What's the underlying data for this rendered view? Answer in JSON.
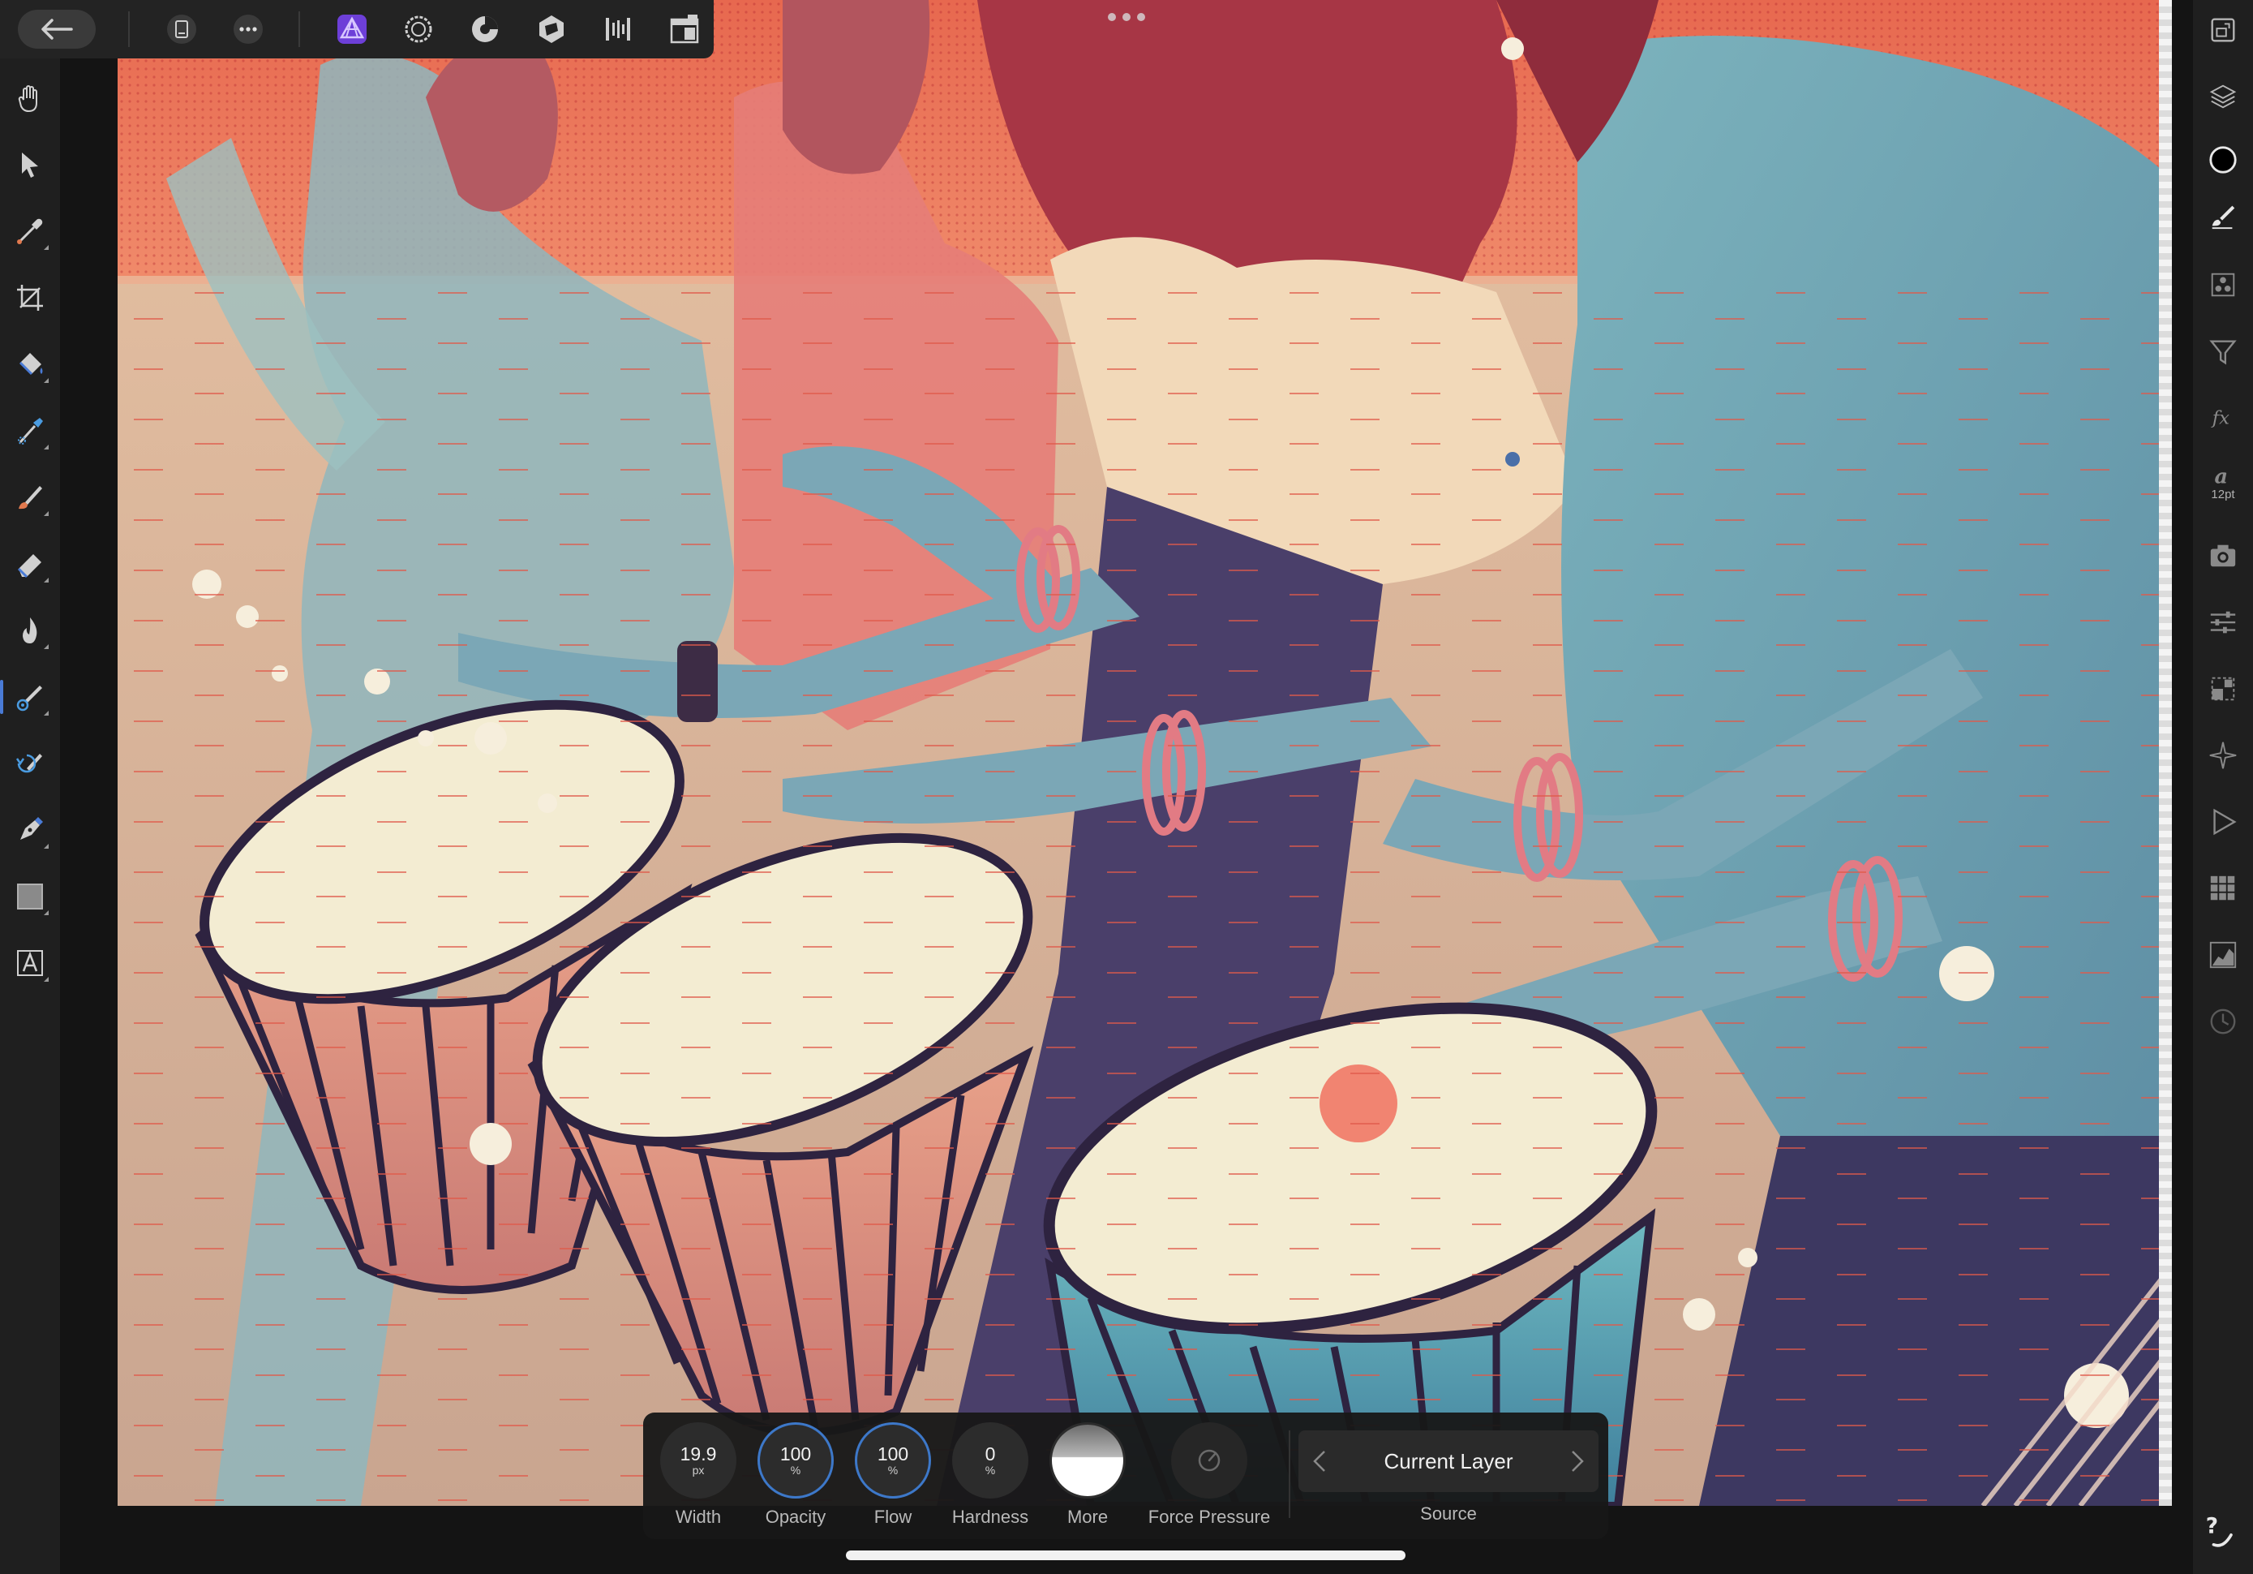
{
  "app": {
    "name": "Affinity Photo"
  },
  "top_toolbar": {
    "back_icon": "arrow-left-icon",
    "items": [
      {
        "name": "document-menu",
        "icon": "document-icon"
      },
      {
        "name": "more-menu",
        "icon": "ellipsis-icon"
      },
      {
        "name": "photo-persona",
        "icon": "photo-persona-icon",
        "active": true
      },
      {
        "name": "liquify-persona",
        "icon": "liquify-persona-icon"
      },
      {
        "name": "develop-persona",
        "icon": "develop-persona-icon"
      },
      {
        "name": "tone-mapping-persona",
        "icon": "tone-mapping-persona-icon"
      },
      {
        "name": "export-persona",
        "icon": "export-persona-icon"
      },
      {
        "name": "view-options",
        "icon": "view-options-icon"
      }
    ]
  },
  "left_tools": [
    {
      "name": "view-tool",
      "icon": "hand-icon"
    },
    {
      "name": "move-tool",
      "icon": "arrow-pointer-icon"
    },
    {
      "name": "color-picker-tool",
      "icon": "eyedropper-icon"
    },
    {
      "name": "crop-tool",
      "icon": "crop-icon"
    },
    {
      "name": "flood-fill-tool",
      "icon": "paint-bucket-icon"
    },
    {
      "name": "selection-brush-tool",
      "icon": "selection-brush-icon"
    },
    {
      "name": "paint-brush-tool",
      "icon": "paint-brush-icon"
    },
    {
      "name": "erase-brush-tool",
      "icon": "eraser-icon"
    },
    {
      "name": "dodge-brush-tool",
      "icon": "flame-icon"
    },
    {
      "name": "clone-brush-tool",
      "icon": "clone-brush-icon",
      "active": true
    },
    {
      "name": "undo-brush-tool",
      "icon": "undo-brush-icon"
    },
    {
      "name": "pen-tool",
      "icon": "pen-nib-icon"
    },
    {
      "name": "rectangle-tool",
      "icon": "rectangle-icon"
    },
    {
      "name": "text-tool",
      "icon": "text-frame-icon"
    }
  ],
  "right_studios": [
    {
      "name": "navigator-studio",
      "icon": "navigator-icon"
    },
    {
      "name": "layers-studio",
      "icon": "layers-icon"
    },
    {
      "name": "color-studio",
      "icon": "color-circle-icon"
    },
    {
      "name": "brushes-studio",
      "icon": "brush-studio-icon"
    },
    {
      "name": "channels-studio",
      "icon": "channels-icon"
    },
    {
      "name": "filters-studio",
      "icon": "filter-funnel-icon"
    },
    {
      "name": "effects-studio",
      "icon": "fx-icon"
    },
    {
      "name": "character-studio",
      "icon": "character-icon",
      "sub": "12pt"
    },
    {
      "name": "stock-studio",
      "icon": "camera-icon"
    },
    {
      "name": "adjustments-studio",
      "icon": "sliders-icon"
    },
    {
      "name": "transform-studio",
      "icon": "transform-icon"
    },
    {
      "name": "snapping-studio",
      "icon": "snapping-icon"
    },
    {
      "name": "macro-studio",
      "icon": "play-icon"
    },
    {
      "name": "library-studio",
      "icon": "grid-icon"
    },
    {
      "name": "histogram-studio",
      "icon": "histogram-icon"
    },
    {
      "name": "history-studio",
      "icon": "history-clock-icon"
    }
  ],
  "help_icon": "help-question-icon",
  "context_toolbar": {
    "controls": [
      {
        "name": "width-control",
        "value": "19.9",
        "unit": "px",
        "label": "Width",
        "ring": false
      },
      {
        "name": "opacity-control",
        "value": "100",
        "unit": "%",
        "label": "Opacity",
        "ring": true
      },
      {
        "name": "flow-control",
        "value": "100",
        "unit": "%",
        "label": "Flow",
        "ring": true
      },
      {
        "name": "hardness-control",
        "value": "0",
        "unit": "%",
        "label": "Hardness",
        "ring": false
      }
    ],
    "more_label": "More",
    "force_pressure_label": "Force Pressure",
    "source": {
      "value": "Current Layer",
      "label": "Source"
    }
  },
  "colors": {
    "accent": "#3d78c9",
    "active_persona": "#8a5cf6",
    "toolbar_bg": "#1f1f1f"
  }
}
